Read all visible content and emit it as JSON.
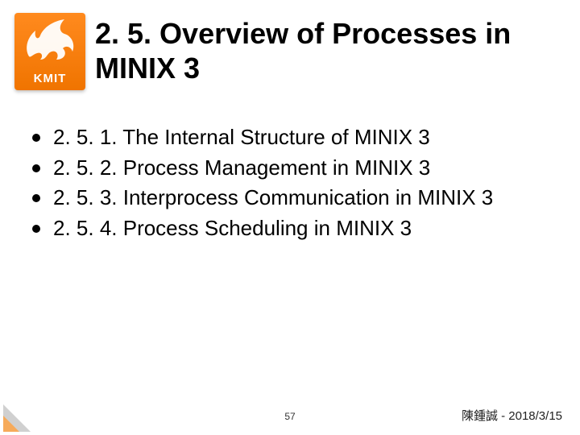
{
  "logo": {
    "label": "KMIT"
  },
  "title": "2. 5. Overview of Processes in MINIX 3",
  "bullets": [
    "2. 5. 1. The Internal Structure of MINIX 3",
    "2. 5. 2. Process Management in MINIX 3",
    "2. 5. 3. Interprocess Communication in MINIX 3",
    "2. 5. 4. Process Scheduling in MINIX 3"
  ],
  "page_number": "57",
  "footer": "陳鍾誠 - 2018/3/15"
}
